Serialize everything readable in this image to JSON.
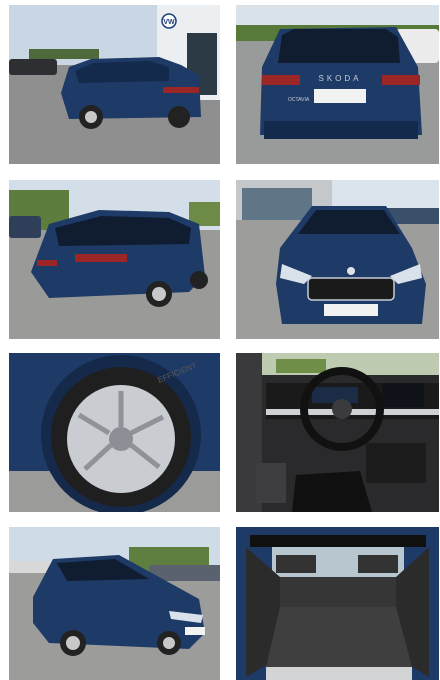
{
  "gallery": {
    "photos": [
      {
        "subject": "rear-three-quarter-showroom"
      },
      {
        "subject": "rear-view"
      },
      {
        "subject": "rear-three-quarter-parking"
      },
      {
        "subject": "front-view"
      },
      {
        "subject": "wheel-closeup"
      },
      {
        "subject": "interior-dashboard"
      },
      {
        "subject": "front-three-quarter"
      },
      {
        "subject": "trunk-cargo-area"
      }
    ],
    "car_badge_rear": "SKODA",
    "car_model_rear": "OCTAVIA",
    "tire_text": "EFFICIENT",
    "dealer_brand_sign": "VW"
  },
  "colors": {
    "car_body": "#1e3a66",
    "car_dark": "#142a4c",
    "sky": "#c9d6e3",
    "asphalt": "#8d8d8d",
    "foliage": "#5d7d3e",
    "interior": "#2a2a2c"
  }
}
